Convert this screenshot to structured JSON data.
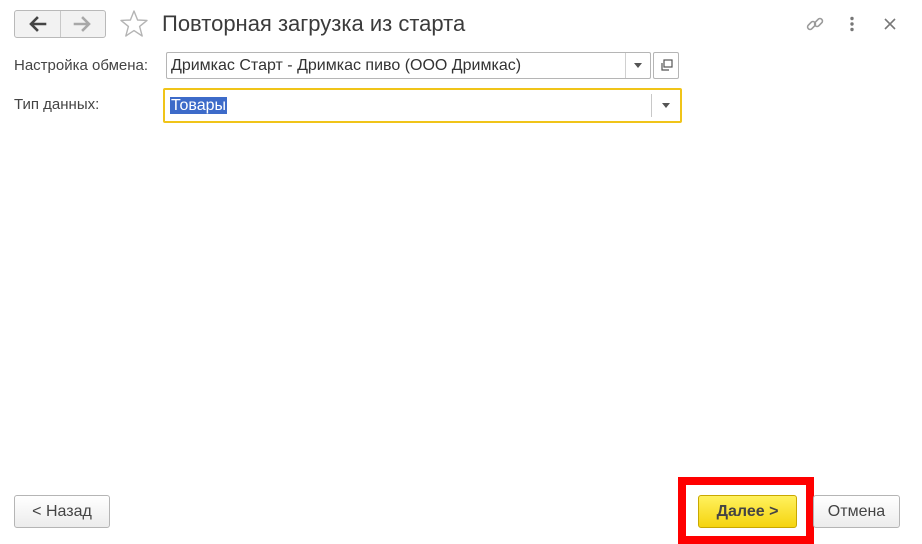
{
  "window": {
    "title": "Повторная загрузка из старта"
  },
  "form": {
    "exchange_setting": {
      "label": "Настройка обмена:",
      "value": "Дримкас Старт - Дримкас пиво (ООО Дримкас)"
    },
    "data_type": {
      "label": "Тип данных:",
      "value": "Товары"
    }
  },
  "buttons": {
    "back": "< Назад",
    "next": "Далее >",
    "cancel": "Отмена"
  },
  "colors": {
    "accent_yellow": "#f5d40f",
    "focus_border": "#f0c419",
    "highlight_red": "#ff0000",
    "selection_blue": "#3d6bc9"
  },
  "icons": [
    "back-arrow-icon",
    "forward-arrow-icon",
    "star-icon",
    "link-icon",
    "more-vertical-icon",
    "close-icon",
    "chevron-down-icon",
    "open-window-icon"
  ]
}
